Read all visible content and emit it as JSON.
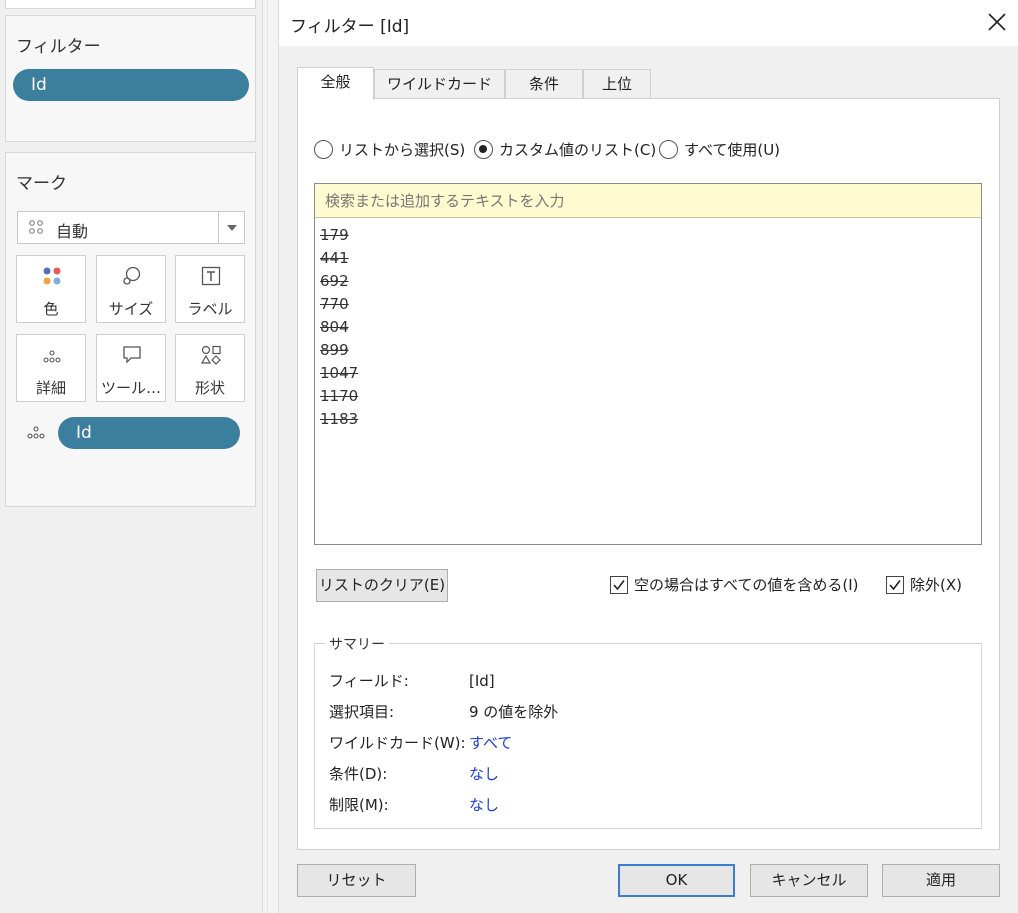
{
  "left_panel": {
    "filters": {
      "title": "フィルター",
      "pill": "Id"
    },
    "marks": {
      "title": "マーク",
      "mark_type": "自動",
      "buttons": {
        "color": "色",
        "size": "サイズ",
        "label": "ラベル",
        "detail": "詳細",
        "tooltip": "ツール…",
        "shape": "形状"
      },
      "detail_pill": "Id"
    }
  },
  "dialog": {
    "title": "フィルター [Id]",
    "tabs": [
      {
        "label": "全般"
      },
      {
        "label": "ワイルドカード"
      },
      {
        "label": "条件"
      },
      {
        "label": "上位"
      }
    ],
    "options": {
      "select_from_list": "リストから選択(S)",
      "custom_value_list": "カスタム値のリスト(C)",
      "use_all": "すべて使用(U)",
      "selected": "custom_value_list"
    },
    "search": {
      "placeholder": "検索または追加するテキストを入力"
    },
    "values": [
      "179",
      "441",
      "692",
      "770",
      "804",
      "899",
      "1047",
      "1170",
      "1183"
    ],
    "clear_list_button": "リストのクリア(E)",
    "include_all_when_empty": {
      "label": "空の場合はすべての値を含める(I)",
      "checked": true
    },
    "exclude": {
      "label": "除外(X)",
      "checked": true
    },
    "summary": {
      "legend": "サマリー",
      "field_key": "フィールド:",
      "field_value": "[Id]",
      "selection_key": "選択項目:",
      "selection_value": "9 の値を除外",
      "wildcard_key": "ワイルドカード(W):",
      "wildcard_value": "すべて",
      "condition_key": "条件(D):",
      "condition_value": "なし",
      "limit_key": "制限(M):",
      "limit_value": "なし"
    },
    "footer": {
      "reset": "リセット",
      "ok": "OK",
      "cancel": "キャンセル",
      "apply": "適用"
    },
    "colors": {
      "link": "#1a3fd6",
      "pill": "#3c7e9d",
      "search_bg": "#fffbd0"
    }
  }
}
